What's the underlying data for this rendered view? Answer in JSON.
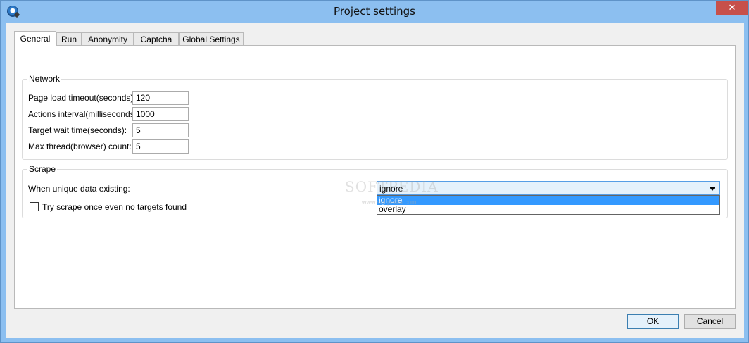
{
  "window": {
    "title": "Project settings",
    "close_glyph": "✕",
    "icon": "app-globe-icon"
  },
  "tabs": [
    {
      "label": "General",
      "active": true
    },
    {
      "label": "Run",
      "active": false
    },
    {
      "label": "Anonymity",
      "active": false
    },
    {
      "label": "Captcha",
      "active": false
    },
    {
      "label": "Global Settings",
      "active": false
    }
  ],
  "network": {
    "legend": "Network",
    "fields": [
      {
        "label": "Page load timeout(seconds):",
        "value": "120"
      },
      {
        "label": "Actions interval(milliseconds):",
        "value": "1000"
      },
      {
        "label": "Target wait time(seconds):",
        "value": "5"
      },
      {
        "label": "Max thread(browser) count:",
        "value": "5"
      }
    ]
  },
  "scrape": {
    "legend": "Scrape",
    "unique_label": "When unique data existing:",
    "unique_selected": "ignore",
    "unique_options": [
      "ignore",
      "overlay"
    ],
    "try_once_label": "Try scrape once even no targets found",
    "try_once_checked": false
  },
  "watermark": {
    "text": "SOFTPEDIA",
    "sub": "www.softpedia.com"
  },
  "buttons": {
    "ok": "OK",
    "cancel": "Cancel"
  },
  "colors": {
    "titlebar": "#8cbff0",
    "close": "#c7504a",
    "selection": "#3399ff"
  }
}
